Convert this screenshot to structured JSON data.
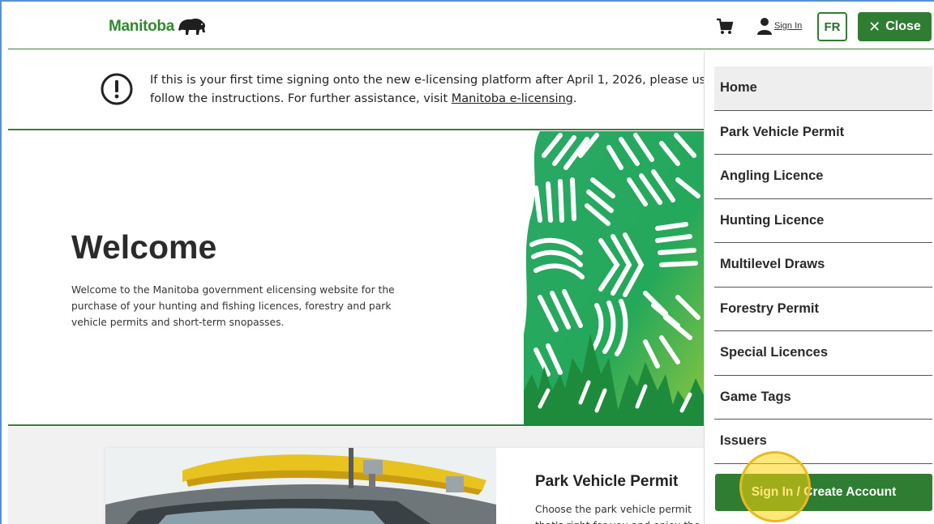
{
  "header": {
    "logo_text": "Manitoba",
    "cart_icon": "shopping-cart-icon",
    "user_icon": "person-icon",
    "signin_label": "Sign In",
    "language_label": "FR",
    "close_label": "Close",
    "close_icon": "close-icon"
  },
  "notice": {
    "icon": "exclamation-circle-icon",
    "line1": "If this is your first time signing onto the new e-licensing platform after April 1, 2026, please use the",
    "line2_prefix": "follow the instructions. For further assistance, visit ",
    "link_text": "Manitoba e-licensing",
    "line2_suffix": "."
  },
  "hero": {
    "title": "Welcome",
    "body": "Welcome to the Manitoba government elicensing website for the purchase of your hunting and fishing licences, forestry and park vehicle permits and short-term snopasses."
  },
  "card": {
    "title": "Park Vehicle Permit",
    "description": "Choose the park vehicle permit that's right for you and enjoy the outdoors."
  },
  "drawer": {
    "menu": [
      {
        "label": "Home",
        "active": true
      },
      {
        "label": "Park Vehicle Permit"
      },
      {
        "label": "Angling Licence"
      },
      {
        "label": "Hunting Licence"
      },
      {
        "label": "Multilevel Draws"
      },
      {
        "label": "Forestry Permit"
      },
      {
        "label": "Special Licences"
      },
      {
        "label": "Game Tags"
      },
      {
        "label": "Issuers"
      }
    ],
    "cta_label": "Sign In / Create Account"
  },
  "colors": {
    "brand_green": "#2e7d32",
    "logo_green": "#2f8a2f",
    "highlight": "#ffd60a"
  }
}
